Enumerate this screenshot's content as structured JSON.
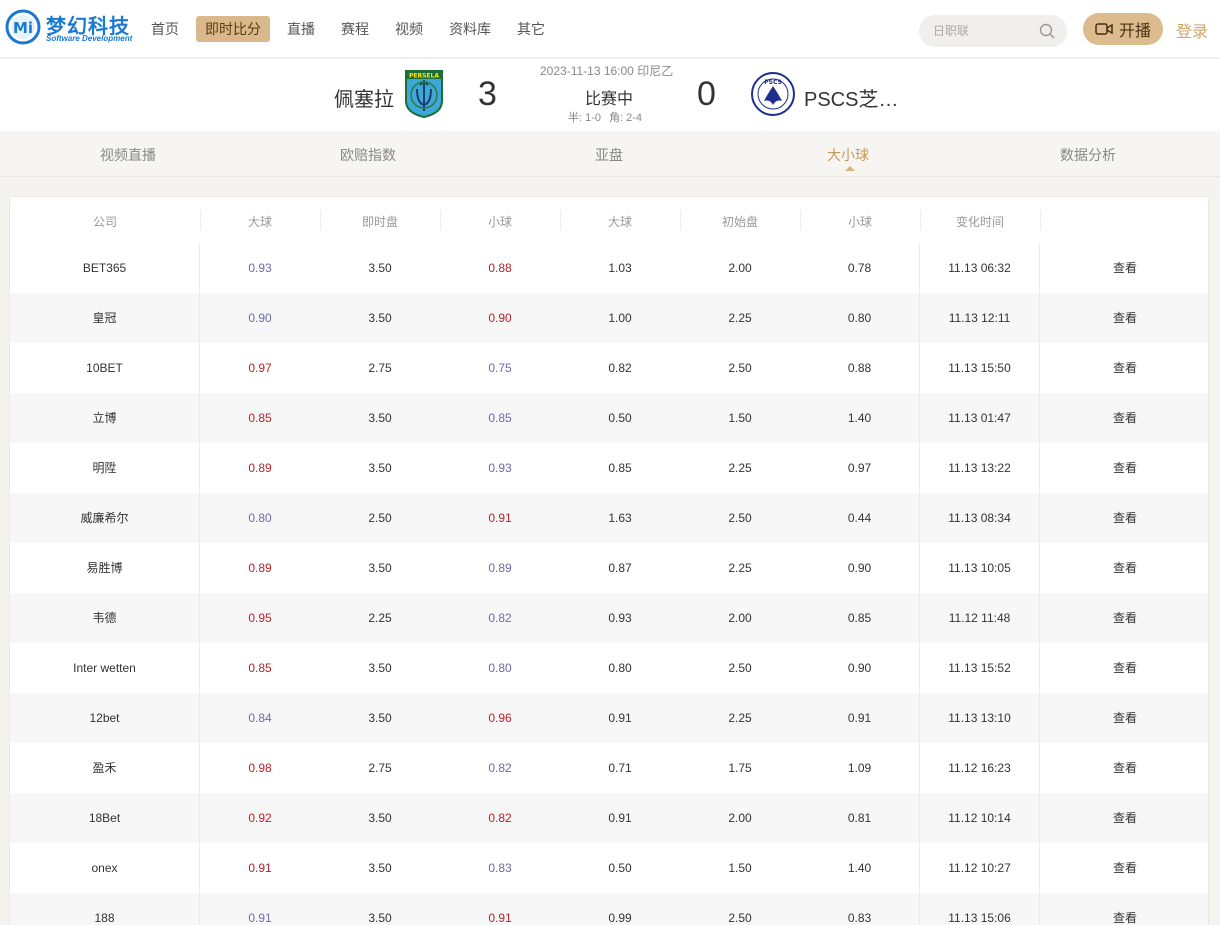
{
  "brand": {
    "name": "梦幻科技",
    "sub": "Software Development",
    "mark": "Mi"
  },
  "nav": [
    {
      "label": "首页",
      "active": false
    },
    {
      "label": "即时比分",
      "active": true
    },
    {
      "label": "直播",
      "active": false
    },
    {
      "label": "赛程",
      "active": false
    },
    {
      "label": "视频",
      "active": false
    },
    {
      "label": "资料库",
      "active": false
    },
    {
      "label": "其它",
      "active": false
    }
  ],
  "search": {
    "placeholder": "日职联"
  },
  "actions": {
    "live_label": "开播",
    "login_label": "登录"
  },
  "match": {
    "home_name": "佩塞拉",
    "home_logo_text": "PERSELA",
    "home_score": "3",
    "away_score": "0",
    "away_name": "PSCS芝…",
    "away_logo_text": "PSCS",
    "datetime": "2023-11-13 16:00 印尼乙",
    "status": "比赛中",
    "half": "半: 1-0",
    "corner": "角: 2-4"
  },
  "tabs": [
    {
      "label": "视频直播",
      "active": false
    },
    {
      "label": "欧赔指数",
      "active": false
    },
    {
      "label": "亚盘",
      "active": false
    },
    {
      "label": "大小球",
      "active": true
    },
    {
      "label": "数据分析",
      "active": false
    }
  ],
  "table": {
    "headers": [
      "公司",
      "大球",
      "即时盘",
      "小球",
      "大球",
      "初始盘",
      "小球",
      "变化时间"
    ],
    "view_label": "查看",
    "rows": [
      {
        "company": "BET365",
        "over": "0.93",
        "over_c": "blue",
        "line": "3.50",
        "under": "0.88",
        "under_c": "red",
        "i_over": "1.03",
        "i_line": "2.00",
        "i_under": "0.78",
        "time": "11.13 06:32"
      },
      {
        "company": "皇冠",
        "over": "0.90",
        "over_c": "blue",
        "line": "3.50",
        "under": "0.90",
        "under_c": "red",
        "i_over": "1.00",
        "i_line": "2.25",
        "i_under": "0.80",
        "time": "11.13 12:11"
      },
      {
        "company": "10BET",
        "over": "0.97",
        "over_c": "red",
        "line": "2.75",
        "under": "0.75",
        "under_c": "blue",
        "i_over": "0.82",
        "i_line": "2.50",
        "i_under": "0.88",
        "time": "11.13 15:50"
      },
      {
        "company": "立博",
        "over": "0.85",
        "over_c": "red",
        "line": "3.50",
        "under": "0.85",
        "under_c": "blue",
        "i_over": "0.50",
        "i_line": "1.50",
        "i_under": "1.40",
        "time": "11.13 01:47"
      },
      {
        "company": "明陞",
        "over": "0.89",
        "over_c": "red",
        "line": "3.50",
        "under": "0.93",
        "under_c": "blue",
        "i_over": "0.85",
        "i_line": "2.25",
        "i_under": "0.97",
        "time": "11.13 13:22"
      },
      {
        "company": "威廉希尔",
        "over": "0.80",
        "over_c": "blue",
        "line": "2.50",
        "under": "0.91",
        "under_c": "red",
        "i_over": "1.63",
        "i_line": "2.50",
        "i_under": "0.44",
        "time": "11.13 08:34"
      },
      {
        "company": "易胜博",
        "over": "0.89",
        "over_c": "red",
        "line": "3.50",
        "under": "0.89",
        "under_c": "blue",
        "i_over": "0.87",
        "i_line": "2.25",
        "i_under": "0.90",
        "time": "11.13 10:05"
      },
      {
        "company": "韦德",
        "over": "0.95",
        "over_c": "red",
        "line": "2.25",
        "under": "0.82",
        "under_c": "blue",
        "i_over": "0.93",
        "i_line": "2.00",
        "i_under": "0.85",
        "time": "11.12 11:48"
      },
      {
        "company": "Inter wetten",
        "over": "0.85",
        "over_c": "red",
        "line": "3.50",
        "under": "0.80",
        "under_c": "blue",
        "i_over": "0.80",
        "i_line": "2.50",
        "i_under": "0.90",
        "time": "11.13 15:52"
      },
      {
        "company": "12bet",
        "over": "0.84",
        "over_c": "blue",
        "line": "3.50",
        "under": "0.96",
        "under_c": "red",
        "i_over": "0.91",
        "i_line": "2.25",
        "i_under": "0.91",
        "time": "11.13 13:10"
      },
      {
        "company": "盈禾",
        "over": "0.98",
        "over_c": "red",
        "line": "2.75",
        "under": "0.82",
        "under_c": "blue",
        "i_over": "0.71",
        "i_line": "1.75",
        "i_under": "1.09",
        "time": "11.12 16:23"
      },
      {
        "company": "18Bet",
        "over": "0.92",
        "over_c": "red",
        "line": "3.50",
        "under": "0.82",
        "under_c": "red",
        "i_over": "0.91",
        "i_line": "2.00",
        "i_under": "0.81",
        "time": "11.12 10:14"
      },
      {
        "company": "onex",
        "over": "0.91",
        "over_c": "red",
        "line": "3.50",
        "under": "0.83",
        "under_c": "blue",
        "i_over": "0.50",
        "i_line": "1.50",
        "i_under": "1.40",
        "time": "11.12 10:27"
      },
      {
        "company": "188",
        "over": "0.91",
        "over_c": "blue",
        "line": "3.50",
        "under": "0.91",
        "under_c": "red",
        "i_over": "0.99",
        "i_line": "2.50",
        "i_under": "0.83",
        "time": "11.13 15:06"
      }
    ]
  },
  "colors": {
    "accent": "#d9b98c",
    "odds_up": "#b5232b",
    "odds_down": "#6e6aa6"
  }
}
